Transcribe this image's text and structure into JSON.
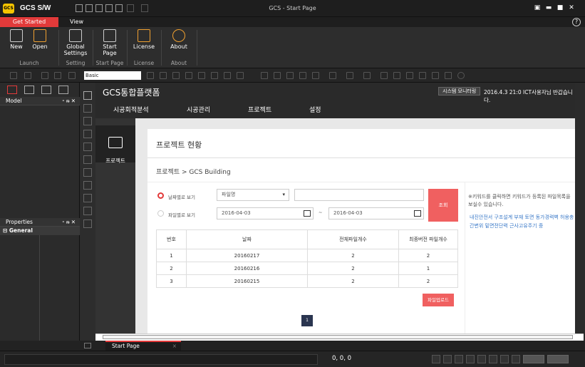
{
  "app": {
    "name": "GCS  S/W",
    "logo": "GCS",
    "window_title": "GCS - Start Page"
  },
  "ribbon": {
    "tabs": [
      {
        "label": "Get Started"
      },
      {
        "label": "View"
      }
    ],
    "buttons": {
      "new": "New",
      "open": "Open",
      "global": "Global Settings",
      "start": "Start Page",
      "license": "License",
      "about": "About"
    },
    "groups": {
      "launch": "Launch",
      "setting": "Setting",
      "start": "Start Page",
      "license": "License",
      "about": "About"
    }
  },
  "toolbar": {
    "combo_value": "Basic"
  },
  "panels": {
    "model": "Model",
    "properties": "Properties",
    "general": "General"
  },
  "web": {
    "brand": "GCS통합플랫폼",
    "monitor_btn": "시스템 모니터링",
    "user_info": "2016.4.3 21:0  ICT사용자님 반갑습니다.",
    "nav": [
      "시공회적분석",
      "시공관리",
      "프로젝트",
      "설정"
    ],
    "side_label": "프로젝트",
    "card_title": "프로젝트 현황",
    "breadcrumb": "프로젝트 > GCS Building",
    "filter": {
      "by_keyword": "날짜별로 보기",
      "by_file": "파일별로 보기",
      "select_value": "파일명",
      "date_from": "2016-04-03",
      "date_to": "2016-04-03",
      "tilde": "~",
      "search_btn": "조회"
    },
    "table": {
      "headers": [
        "번호",
        "날짜",
        "전체파일개수",
        "최종버전 파일개수"
      ],
      "rows": [
        [
          "1",
          "20160217",
          "2",
          "2"
        ],
        [
          "2",
          "20160216",
          "2",
          "1"
        ],
        [
          "3",
          "20160215",
          "2",
          "2"
        ]
      ]
    },
    "upload_btn": "파일업로드",
    "page": "1",
    "hint": "※키워드를 클릭하면 키워드가 등록된 파일목록을 보실수 있습니다.",
    "keywords": "내진안전서 구조설계 부재 토면 동가경력벽 허용충간변위 밑면전단력 근사고유주기 중"
  },
  "doc_tab": {
    "label": "Start Page",
    "close": "×"
  },
  "status": {
    "coords": "0, 0, 0"
  },
  "colors": {
    "accent": "#e23a3a",
    "button": "#f06060",
    "pager": "#2a3550"
  }
}
